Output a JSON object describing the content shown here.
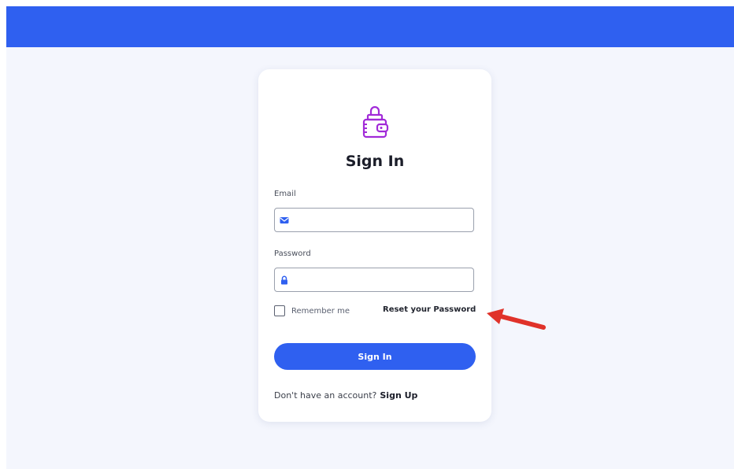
{
  "header": {
    "background": "#2f60f0"
  },
  "card": {
    "logo_icon": "wallet-lock-icon",
    "title": "Sign In",
    "email": {
      "label": "Email",
      "value": "",
      "placeholder": "",
      "icon": "envelope-icon"
    },
    "password": {
      "label": "Password",
      "value": "",
      "placeholder": "",
      "icon": "lock-icon"
    },
    "remember_label": "Remember me",
    "remember_checked": false,
    "reset_link": "Reset your Password",
    "submit_label": "Sign In",
    "footer_prompt": "Don't have an account?",
    "signup_link": "Sign Up"
  },
  "annotation": {
    "icon": "red-arrow-icon",
    "color": "#e0322a"
  },
  "colors": {
    "accent": "#2f60f0",
    "logo": "#a12ad8",
    "background": "#f4f6fd"
  }
}
